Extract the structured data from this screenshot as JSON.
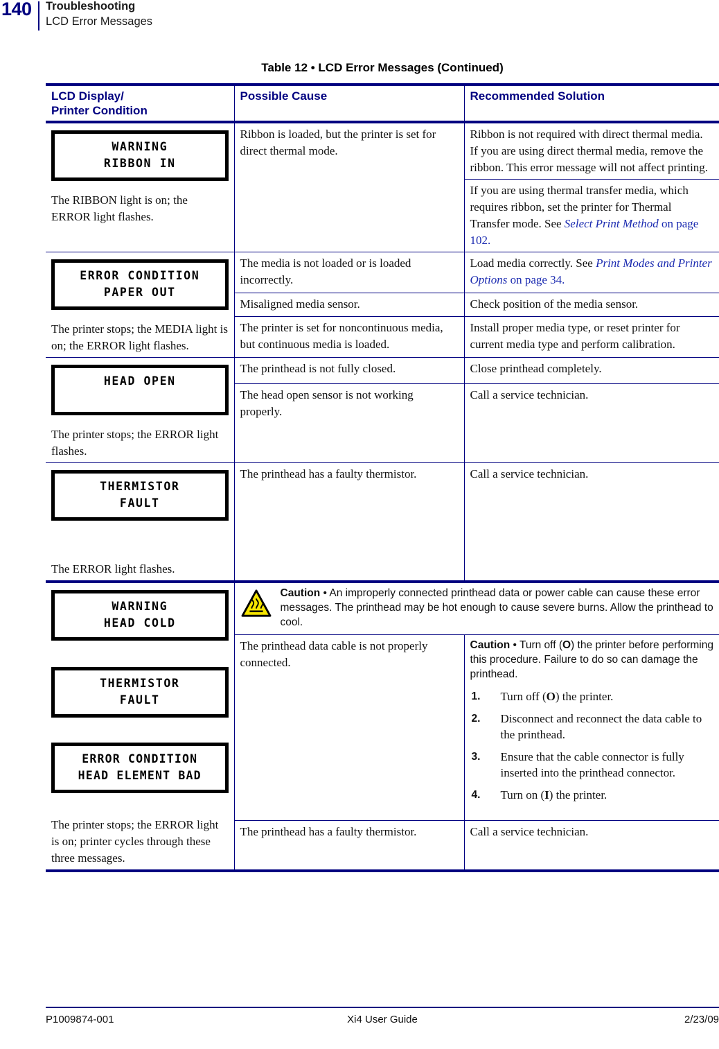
{
  "header": {
    "page_number": "140",
    "chapter": "Troubleshooting",
    "section": "LCD Error Messages"
  },
  "table": {
    "caption": "Table 12 • LCD Error Messages (Continued)",
    "columns": {
      "col1_line1": "LCD Display/",
      "col1_line2": "Printer Condition",
      "col2": "Possible Cause",
      "col3": "Recommended Solution"
    },
    "rows": [
      {
        "id": "ribbon-in",
        "lcd": {
          "line1": "WARNING",
          "line2": "RIBBON IN"
        },
        "condition": "The RIBBON light is on; the ERROR light flashes.",
        "cause": "Ribbon is loaded, but the printer is set for direct thermal mode.",
        "solution_1": "Ribbon is not required with direct thermal media. If you are using direct thermal media, remove the ribbon. This error message will not affect printing.",
        "solution_2_pre": "If you are using thermal transfer media, which requires ribbon, set the printer for Thermal Transfer mode. See ",
        "solution_2_xref": "Select Print Method",
        "solution_2_post": " on page 102."
      },
      {
        "id": "paper-out",
        "lcd": {
          "line1": "ERROR CONDITION",
          "line2": "PAPER OUT"
        },
        "condition": "The printer stops; the MEDIA light is on; the ERROR light flashes.",
        "cause_1": "The media is not loaded or is loaded incorrectly.",
        "solution_1_pre": "Load media correctly. See ",
        "solution_1_xref": "Print Modes and Printer Options",
        "solution_1_post": " on page 34.",
        "cause_2": "Misaligned media sensor.",
        "solution_2": "Check position of the media sensor.",
        "cause_3": "The printer is set for noncontinuous media, but continuous media is loaded.",
        "solution_3": "Install proper media type, or reset printer for current media type and perform calibration."
      },
      {
        "id": "head-open",
        "lcd": {
          "line1": "HEAD OPEN",
          "line2": ""
        },
        "condition": "The printer stops; the ERROR light flashes.",
        "cause_1": "The printhead is not fully closed.",
        "solution_1": "Close printhead completely.",
        "cause_2": "The head open sensor is not working properly.",
        "solution_2": "Call a service technician."
      },
      {
        "id": "thermistor-fault",
        "lcd": {
          "line1": "THERMISTOR",
          "line2": "FAULT"
        },
        "condition": "The ERROR light flashes.",
        "cause": "The printhead has a faulty thermistor.",
        "solution": "Call a service technician."
      },
      {
        "id": "head-cold-group",
        "lcd_1": {
          "line1": "WARNING",
          "line2": "HEAD COLD"
        },
        "lcd_2": {
          "line1": "THERMISTOR",
          "line2": "FAULT"
        },
        "lcd_3": {
          "line1": "ERROR CONDITION",
          "line2": "HEAD ELEMENT BAD"
        },
        "condition": "The printer stops; the ERROR light is on; printer cycles through these three messages.",
        "caution_banner": {
          "label": "Caution",
          "separator": " • ",
          "text": "An improperly connected printhead data or power cable can cause these error messages. The printhead may be hot enough to cause severe burns. Allow the printhead to cool.",
          "icon": "hot-surface-warning-icon",
          "icon_fill": "#F5E400",
          "icon_stroke": "#000000"
        },
        "cause_1": "The printhead data cable is not properly connected.",
        "solution_1_caution_label": "Caution",
        "solution_1_caution_sep": " • ",
        "solution_1_caution_text_a": "Turn off (",
        "solution_1_caution_symbol": "O",
        "solution_1_caution_text_b": ") the printer before performing this procedure. Failure to do so can damage the printhead.",
        "steps": [
          {
            "num": "1.",
            "text_a": "Turn off (",
            "symbol": "O",
            "text_b": ") the printer."
          },
          {
            "num": "2.",
            "text_a": "Disconnect and reconnect the data cable to the printhead.",
            "symbol": "",
            "text_b": ""
          },
          {
            "num": "3.",
            "text_a": "Ensure that the cable connector is fully inserted into the printhead connector.",
            "symbol": "",
            "text_b": ""
          },
          {
            "num": "4.",
            "text_a": "Turn on (",
            "symbol": "I",
            "text_b": ") the printer."
          }
        ],
        "cause_2": "The printhead has a faulty thermistor.",
        "solution_2": "Call a service technician."
      }
    ]
  },
  "footer": {
    "left": "P1009874-001",
    "center": "Xi4 User Guide",
    "right": "2/23/09"
  },
  "colors": {
    "accent_blue": "#000080",
    "xref_blue": "#1a2ab0",
    "caution_yellow": "#F5E400"
  }
}
